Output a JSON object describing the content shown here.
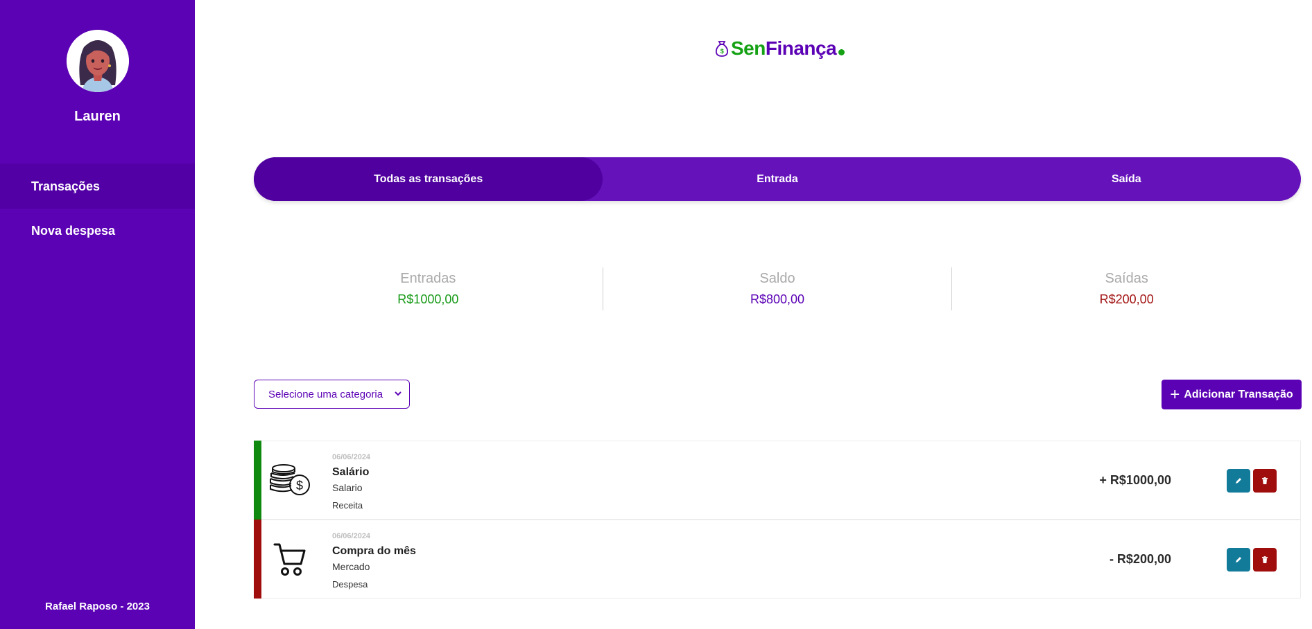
{
  "sidebar": {
    "username": "Lauren",
    "nav": [
      {
        "label": "Transações",
        "active": true
      },
      {
        "label": "Nova despesa",
        "active": false
      }
    ],
    "footer": "Rafael Raposo - 2023"
  },
  "logo": {
    "part1": "Sen",
    "part2": "Finança",
    "icon": "money-bag-icon"
  },
  "tabs": [
    {
      "label": "Todas as transações",
      "active": true
    },
    {
      "label": "Entrada",
      "active": false
    },
    {
      "label": "Saída",
      "active": false
    }
  ],
  "summary": {
    "entradas": {
      "label": "Entradas",
      "value": "R$1000,00"
    },
    "saldo": {
      "label": "Saldo",
      "value": "R$800,00"
    },
    "saidas": {
      "label": "Saídas",
      "value": "R$200,00"
    }
  },
  "filter": {
    "placeholder": "Selecione uma categoria"
  },
  "add_button": {
    "label": "Adicionar Transação"
  },
  "transactions": [
    {
      "date": "06/06/2024",
      "title": "Salário",
      "category": "Salario",
      "type": "Receita",
      "amount": "+ R$1000,00",
      "icon": "coins-icon",
      "color": "#0f8a0f"
    },
    {
      "date": "06/06/2024",
      "title": "Compra do mês",
      "category": "Mercado",
      "type": "Despesa",
      "amount": "- R$200,00",
      "icon": "cart-icon",
      "color": "#a00d0d"
    }
  ],
  "colors": {
    "primary": "#5c02b5",
    "income": "#179a17",
    "expense": "#a31515",
    "edit": "#137b9a",
    "delete": "#a00d0d"
  }
}
